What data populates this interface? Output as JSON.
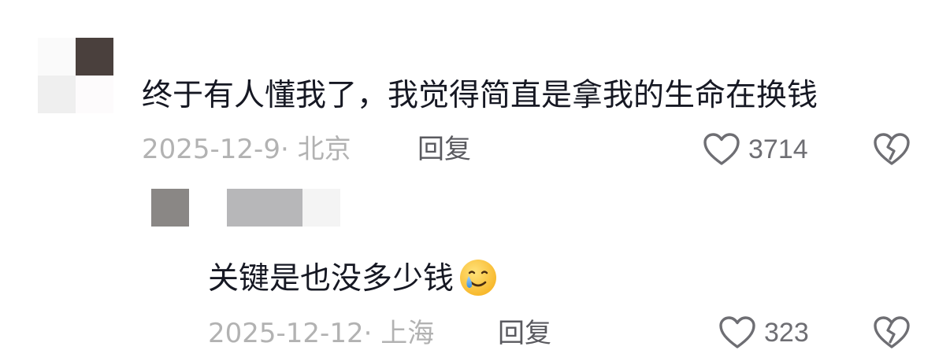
{
  "comments": [
    {
      "text": "终于有人懂我了，我觉得简直是拿我的生命在换钱",
      "date_location": "2025-12-9· 北京",
      "reply_label": "回复",
      "likes": "3714",
      "avatar_icon": "avatar-mosaic"
    }
  ],
  "replies": [
    {
      "text": "关键是也没多少钱",
      "emoji": "crying-smile-emoji",
      "date_location": "2025-12-12· 上海",
      "reply_label": "回复",
      "likes": "323",
      "avatar_icon": "avatar-mosaic"
    }
  ],
  "icons": {
    "like": "heart-outline-icon",
    "dislike": "broken-heart-icon"
  },
  "colors": {
    "text_primary": "#161823",
    "text_meta": "#b2b2b2",
    "reply": "#5a5a5f",
    "icon": "#6e6e73"
  }
}
